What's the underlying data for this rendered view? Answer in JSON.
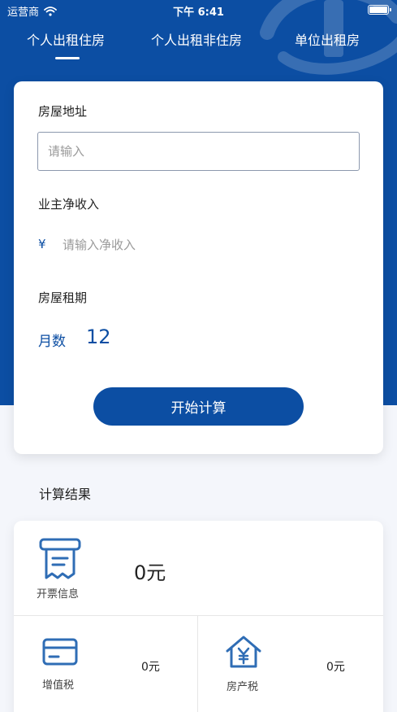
{
  "status_bar": {
    "carrier": "运营商",
    "time": "下午 6:41"
  },
  "tabs": [
    {
      "label": "个人出租住房",
      "active": true
    },
    {
      "label": "个人出租非住房",
      "active": false
    },
    {
      "label": "单位出租房",
      "active": false
    }
  ],
  "form": {
    "address_label": "房屋地址",
    "address_placeholder": "请输入",
    "address_value": "",
    "income_label": "业主净收入",
    "currency_symbol": "¥",
    "income_placeholder": "请输入净收入",
    "income_value": "",
    "term_label": "房屋租期",
    "months_label": "月数",
    "months_value": "12",
    "calculate_button": "开始计算"
  },
  "results": {
    "title": "计算结果",
    "invoice": {
      "label": "开票信息",
      "value": "0元",
      "icon": "receipt-icon"
    },
    "vat": {
      "label": "增值税",
      "value": "0元",
      "icon": "card-icon"
    },
    "property_tax": {
      "label": "房产税",
      "value": "0元",
      "icon": "house-yuan-icon"
    }
  },
  "colors": {
    "primary": "#0c4ea3",
    "background": "#f4f6fb",
    "card": "#ffffff"
  }
}
